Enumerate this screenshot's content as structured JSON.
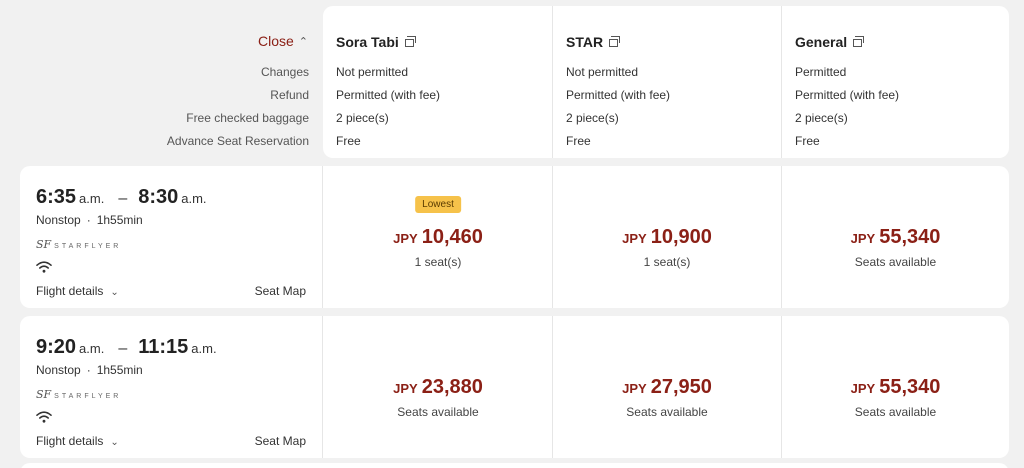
{
  "header": {
    "close_label": "Close",
    "close_chevron": "^",
    "row_labels": [
      "Changes",
      "Refund",
      "Free checked baggage",
      "Advance Seat Reservation"
    ],
    "fares": [
      {
        "name": "Sora Tabi",
        "values": [
          "Not permitted",
          "Permitted (with fee)",
          "2 piece(s)",
          "Free"
        ]
      },
      {
        "name": "STAR",
        "values": [
          "Not permitted",
          "Permitted (with fee)",
          "2 piece(s)",
          "Free"
        ]
      },
      {
        "name": "General",
        "values": [
          "Permitted",
          "Permitted (with fee)",
          "2 piece(s)",
          "Free"
        ]
      }
    ]
  },
  "flights": [
    {
      "dep_time": "6:35",
      "dep_ampm": "a.m.",
      "arr_time": "8:30",
      "arr_ampm": "a.m.",
      "dash": "–",
      "stops": "Nonstop",
      "sep": "·",
      "duration": "1h55min",
      "airline": "STARFLYER",
      "airline_mark": "SF",
      "details_label": "Flight details",
      "seat_map_label": "Seat Map",
      "prices": [
        {
          "badge": "Lowest",
          "currency": "JPY",
          "amount": "10,460",
          "availability": "1 seat(s)"
        },
        {
          "currency": "JPY",
          "amount": "10,900",
          "availability": "1 seat(s)"
        },
        {
          "currency": "JPY",
          "amount": "55,340",
          "availability": "Seats available"
        }
      ]
    },
    {
      "dep_time": "9:20",
      "dep_ampm": "a.m.",
      "arr_time": "11:15",
      "arr_ampm": "a.m.",
      "dash": "–",
      "stops": "Nonstop",
      "sep": "·",
      "duration": "1h55min",
      "airline": "STARFLYER",
      "airline_mark": "SF",
      "details_label": "Flight details",
      "seat_map_label": "Seat Map",
      "prices": [
        {
          "currency": "JPY",
          "amount": "23,880",
          "availability": "Seats available"
        },
        {
          "currency": "JPY",
          "amount": "27,950",
          "availability": "Seats available"
        },
        {
          "currency": "JPY",
          "amount": "55,340",
          "availability": "Seats available"
        }
      ]
    }
  ],
  "colors": {
    "price": "#8b2016",
    "badge": "#f6c24a",
    "background": "#f1f1f1"
  },
  "icons": {
    "external": "external-link-icon",
    "wifi": "wifi-icon",
    "chevron": "chevron-down-icon"
  }
}
